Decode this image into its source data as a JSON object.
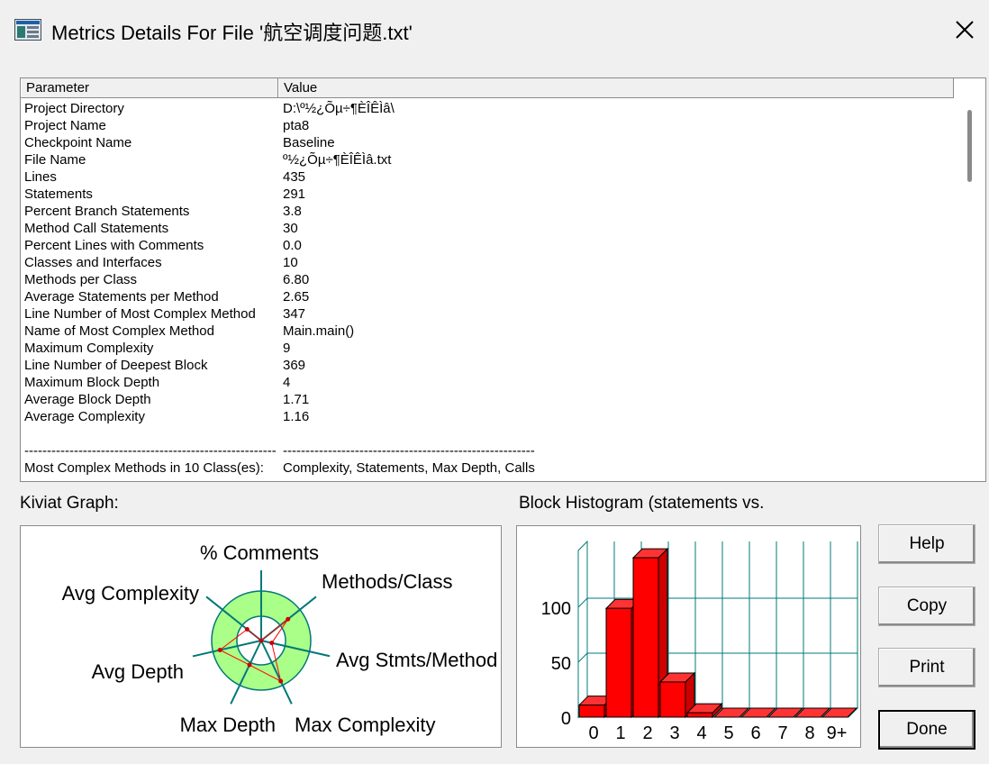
{
  "window": {
    "title": "Metrics Details For File '航空调度问题.txt'",
    "app_icon": "metrics-window-icon",
    "close_icon": "close-icon"
  },
  "table": {
    "headers": [
      "Parameter",
      "Value"
    ],
    "rows": [
      {
        "p": "Project Directory",
        "v": "D:\\º½¿Õµ÷¶ÈÎÊÌâ\\"
      },
      {
        "p": "Project Name",
        "v": "pta8"
      },
      {
        "p": "Checkpoint Name",
        "v": "Baseline"
      },
      {
        "p": "File Name",
        "v": "º½¿Õµ÷¶ÈÎÊÌâ.txt"
      },
      {
        "p": "Lines",
        "v": "435"
      },
      {
        "p": "Statements",
        "v": "291"
      },
      {
        "p": "Percent Branch Statements",
        "v": "3.8"
      },
      {
        "p": "Method Call Statements",
        "v": "30"
      },
      {
        "p": "Percent Lines with Comments",
        "v": "0.0"
      },
      {
        "p": "Classes and Interfaces",
        "v": "10"
      },
      {
        "p": "Methods per Class",
        "v": "6.80"
      },
      {
        "p": "Average Statements per Method",
        "v": "2.65"
      },
      {
        "p": "Line Number of Most Complex Method",
        "v": "347"
      },
      {
        "p": "Name of Most Complex Method",
        "v": "Main.main()"
      },
      {
        "p": "Maximum Complexity",
        "v": "9"
      },
      {
        "p": "Line Number of Deepest Block",
        "v": "369"
      },
      {
        "p": "Maximum Block Depth",
        "v": "4"
      },
      {
        "p": "Average Block Depth",
        "v": "1.71"
      },
      {
        "p": "Average Complexity",
        "v": "1.16"
      },
      {
        "p": "",
        "v": ""
      },
      {
        "p": "--------------------------------------------------------",
        "v": "--------------------------------------------------------"
      },
      {
        "p": "Most Complex Methods in 10 Class(es):",
        "v": "Complexity, Statements, Max Depth, Calls"
      }
    ]
  },
  "kiviat": {
    "label": "Kiviat Graph:",
    "axes": [
      "% Comments",
      "Methods/Class",
      "Avg Stmts/Method",
      "Max Complexity",
      "Max Depth",
      "Avg Depth",
      "Avg Complexity"
    ],
    "colors": {
      "ring": "#aaff88",
      "axis": "#007878",
      "polygon": "#ff0000"
    }
  },
  "histogram": {
    "label": "Block Histogram (statements vs.",
    "chart_data": {
      "type": "bar",
      "categories": [
        "0",
        "1",
        "2",
        "3",
        "4",
        "5",
        "6",
        "7",
        "8",
        "9+"
      ],
      "values": [
        11,
        99,
        145,
        32,
        4,
        0,
        0,
        0,
        0,
        0
      ],
      "yticks": [
        "0",
        "50",
        "100"
      ],
      "ylim": [
        0,
        150
      ],
      "bar_color": "#ff0000",
      "grid_color": "#007878"
    }
  },
  "buttons": {
    "help": "Help",
    "copy": "Copy",
    "print": "Print",
    "done": "Done"
  }
}
